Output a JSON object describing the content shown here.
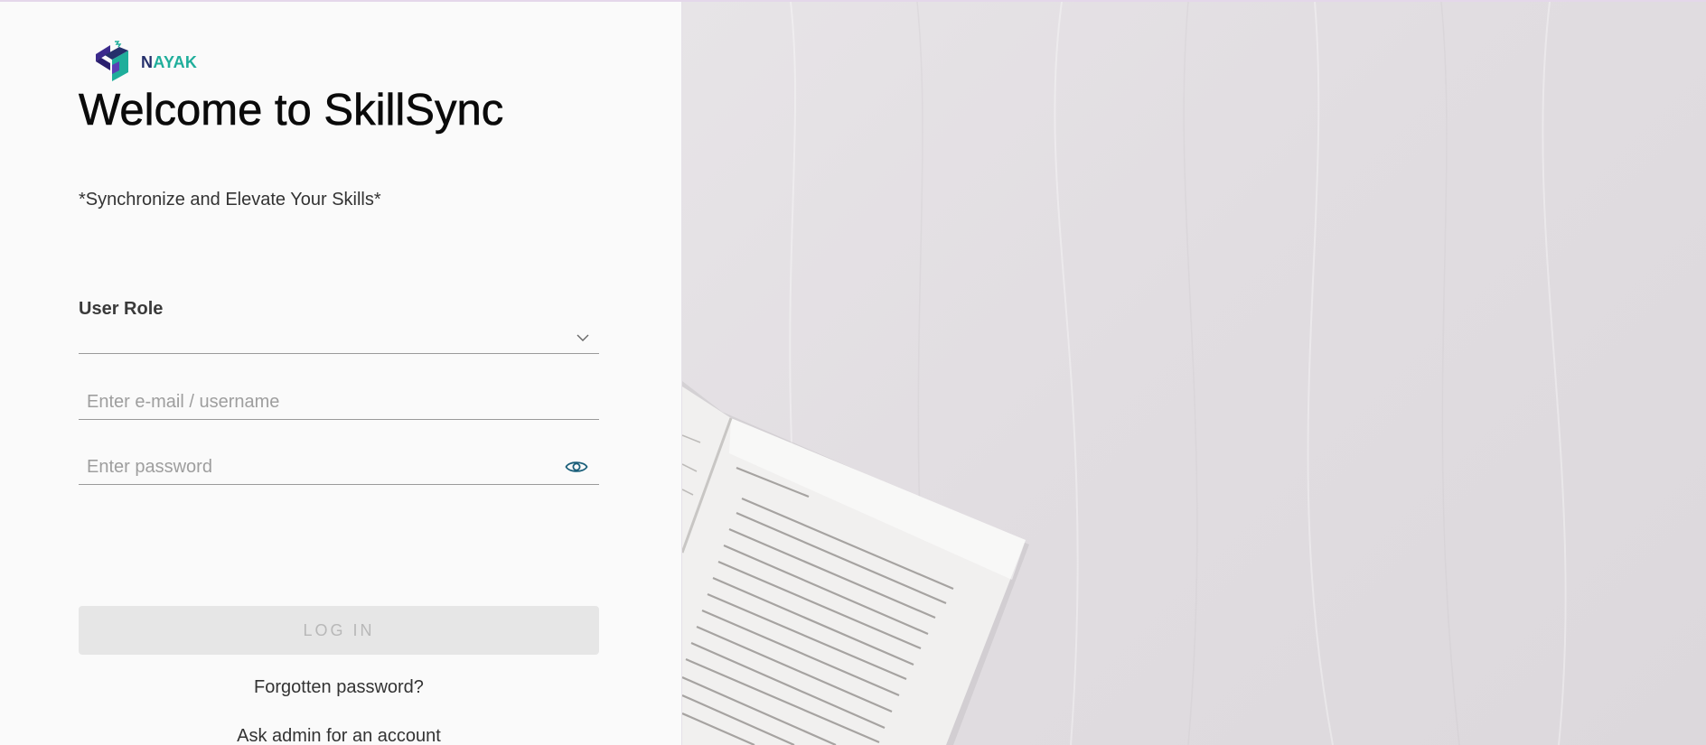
{
  "brand": {
    "logo_text_first": "N",
    "logo_text_rest": "AYAK",
    "logo_icon": "nayak-logo-icon",
    "colors": {
      "navy": "#25306b",
      "teal": "#1fae9b",
      "accent_icon": "#1a5f7a"
    }
  },
  "page": {
    "title": "Welcome to SkillSync",
    "subtitle": "*Synchronize and Elevate Your Skills*"
  },
  "form": {
    "user_role": {
      "label": "User Role",
      "value": "",
      "icon": "chevron-down-icon"
    },
    "email": {
      "placeholder": "Enter e-mail / username",
      "value": ""
    },
    "password": {
      "placeholder": "Enter password",
      "value": "",
      "icon": "eye-icon"
    },
    "login_label": "LOG IN",
    "forgot_label": "Forgotten password?",
    "ask_admin_label": "Ask admin for an account"
  },
  "hero_image": {
    "subject": "open-book-on-white-fabric"
  }
}
